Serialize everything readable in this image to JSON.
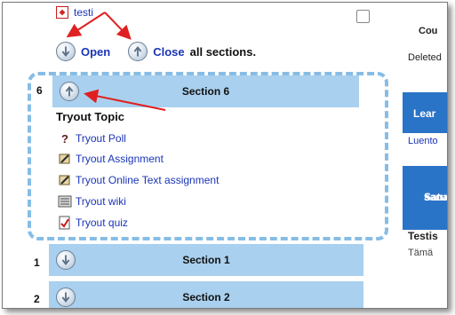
{
  "top": {
    "file_link": "testi"
  },
  "controls": {
    "open_label": "Open",
    "close_label": "Close",
    "suffix": "all sections."
  },
  "right": {
    "header": "Cou",
    "deleted": "Deleted",
    "blue1": "Lear",
    "link": "Luento",
    "blue2_line1": "Satu",
    "blue2_line2": "sanas",
    "testis": "Testis",
    "tama": "Tämä"
  },
  "section6": {
    "number": "6",
    "title": "Section 6",
    "topic": "Tryout Topic",
    "activities": [
      {
        "label": "Tryout Poll",
        "icon": "question-icon"
      },
      {
        "label": "Tryout Assignment",
        "icon": "assignment-icon"
      },
      {
        "label": "Tryout Online Text assignment",
        "icon": "assignment-icon"
      },
      {
        "label": "Tryout wiki",
        "icon": "wiki-icon"
      },
      {
        "label": "Tryout quiz",
        "icon": "quiz-icon"
      }
    ]
  },
  "sections": [
    {
      "number": "1",
      "title": "Section 1"
    },
    {
      "number": "2",
      "title": "Section 2"
    }
  ],
  "colors": {
    "link": "#1a35b8",
    "section_bar": "#a9d0ee",
    "dash": "#86bde6",
    "annotation": "#e02020",
    "block_blue": "#2a74c7"
  }
}
